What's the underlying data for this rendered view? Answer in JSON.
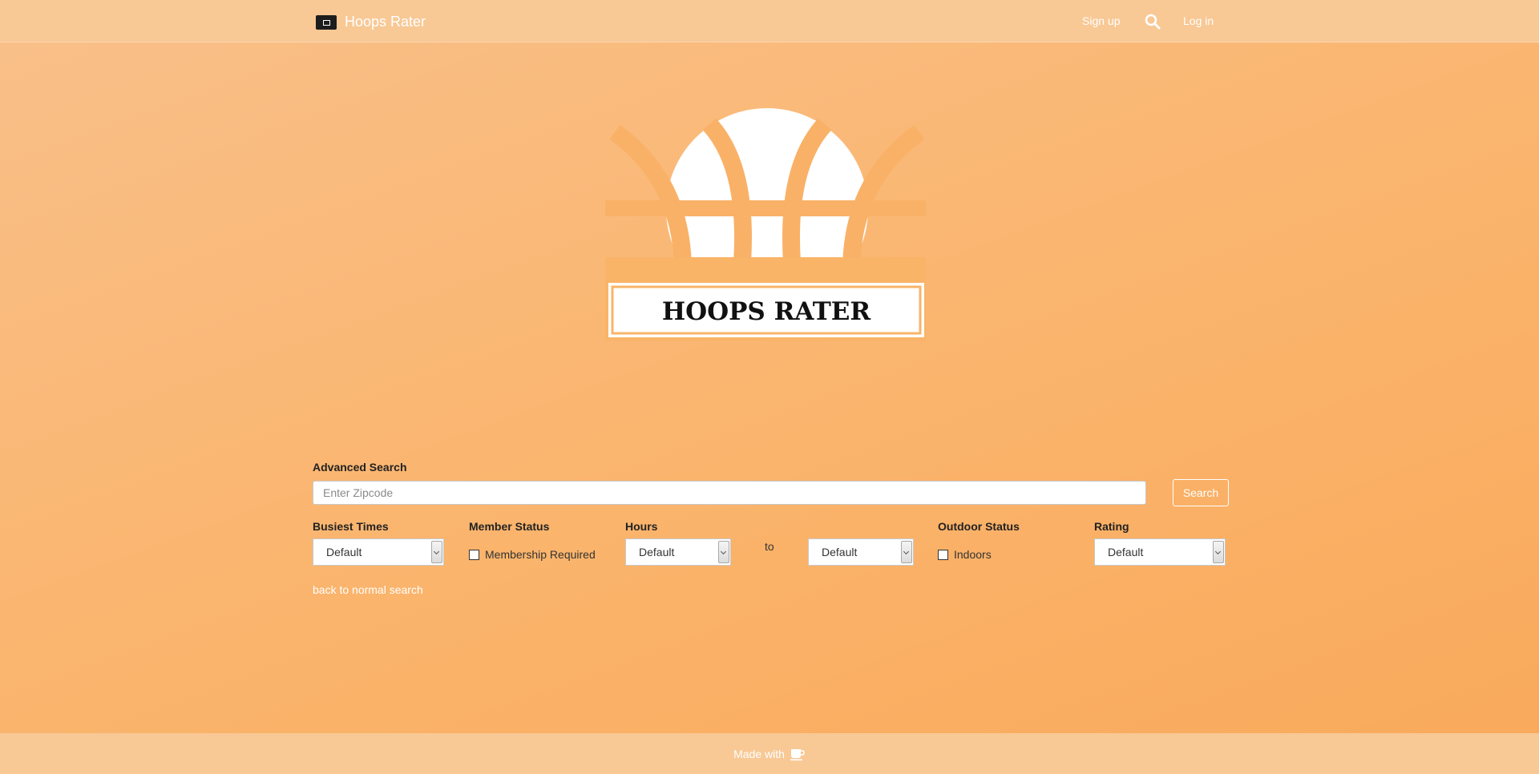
{
  "nav": {
    "brand": "Hoops Rater",
    "signup": "Sign up",
    "login": "Log in"
  },
  "logo": {
    "text": "HOOPS RATER"
  },
  "search": {
    "section_label": "Advanced Search",
    "zip_placeholder": "Enter Zipcode",
    "zip_value": "",
    "button_label": "Search"
  },
  "filters": {
    "busiest_times": {
      "label": "Busiest Times",
      "value": "Default"
    },
    "member_status": {
      "label": "Member Status",
      "checkbox_label": "Membership Required",
      "checked": false
    },
    "hours": {
      "label": "Hours",
      "from_value": "Default",
      "separator": "to",
      "to_value": "Default"
    },
    "outdoor_status": {
      "label": "Outdoor Status",
      "checkbox_label": "Indoors",
      "checked": false
    },
    "rating": {
      "label": "Rating",
      "value": "Default"
    }
  },
  "back_link": "back to normal search",
  "footer": {
    "text": "Made with",
    "icon": "coffee-cup-icon"
  },
  "colors": {
    "background": "#fab46c",
    "navbar": "#f8c895",
    "text_dark": "#222222",
    "white": "#ffffff"
  }
}
